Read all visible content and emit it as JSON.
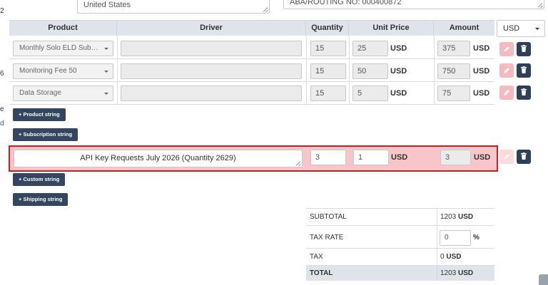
{
  "address": {
    "country": "United States",
    "routing": "ABA/ROUTING NO: 000400872"
  },
  "table": {
    "headers": {
      "product": "Product",
      "driver": "Driver",
      "quantity": "Quantity",
      "unit_price": "Unit Price",
      "amount": "Amount"
    },
    "currency_select": "USD",
    "rows": [
      {
        "product": "Monthly Solo ELD Subscript…",
        "driver": "",
        "quantity": "15",
        "unit_price": "25",
        "unit_currency": "USD",
        "amount": "375",
        "amount_currency": "USD"
      },
      {
        "product": "Monitoring Fee 50",
        "driver": "",
        "quantity": "15",
        "unit_price": "50",
        "unit_currency": "USD",
        "amount": "750",
        "amount_currency": "USD"
      },
      {
        "product": "Data Storage",
        "driver": "",
        "quantity": "15",
        "unit_price": "5",
        "unit_currency": "USD",
        "amount": "75",
        "amount_currency": "USD"
      }
    ],
    "custom_row": {
      "description": "API Key Requests July 2026 (Quantity 2629)",
      "quantity": "3",
      "unit_price": "1",
      "unit_currency": "USD",
      "amount": "3",
      "amount_currency": "USD"
    }
  },
  "buttons": {
    "product_string": "+ Product string",
    "subscription_string": "+ Subscription string",
    "custom_string": "+ Custom string",
    "shipping_string": "+ Shipping string"
  },
  "summary": {
    "subtotal_label": "SUBTOTAL",
    "subtotal_value": "1203",
    "subtotal_currency": "USD",
    "tax_rate_label": "TAX RATE",
    "tax_rate_value": "0",
    "tax_rate_unit": "%",
    "tax_label": "TAX",
    "tax_value": "0",
    "tax_currency": "USD",
    "total_label": "TOTAL",
    "total_value": "1203",
    "total_currency": "USD"
  },
  "colors": {
    "header_bg": "#dfe4ea",
    "button_dark": "#34455f",
    "edit_pink": "#f6b9c0",
    "highlight_row": "#f8c5cb",
    "highlight_border": "#cc1f1f"
  }
}
